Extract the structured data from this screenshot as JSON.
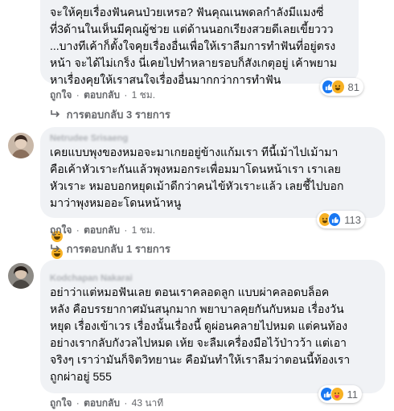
{
  "comments": [
    {
      "author": "",
      "text": "จะให้คุยเรื่องฟันคนป่วยเหรอ? ฟันคุณเนพดลกำลังมีแมงซี่\nที่3ด้านในเห็นมีคุณผู้ช่วย แต่ด้านนอกเรียงสวยดีเลยเขี้ยววว\n...บางทีเค้าก็ตั้งใจคุยเรื่องอื่นเพื่อให้เราลืมการทำฟันที่อยู่ตรง\nหน้า จะได้ไม่เกร็ง นี่เคยไปทำหลายรอบก็สังเกตุอยู่ เค้าพยาม\nหาเรื่องคุยให้เราสนใจเรื่องอื่นมากกว่าการทำฟัน",
      "like_label": "ถูกใจ",
      "reply_label": "ตอบกลับ",
      "time": "1 ชม.",
      "reactions_count": "81",
      "replies_label": "การตอบกลับ 3 รายการ"
    },
    {
      "author": "Netrudee Srisaeng",
      "text": "เคยแบบพุงของหมอจะมาเกยอยู่ข้างแก้มเรา ทีนี้เม้าไปเม้ามา\nคือเค้าหัวเราะกันแล้วพุงหมอกระเพื่อมมาโดนหน้าเรา เราเลย\nหัวเราะ หมอบอกหยุดเม้าดีกว่าคนไข้หัวเราะแล้ว เลยชี้ไปบอก\nมาว่าพุงหมออะโดนหน้าหนู",
      "emojis": [
        "grinning",
        "grinning",
        "grinning",
        "grinning"
      ],
      "like_label": "ถูกใจ",
      "reply_label": "ตอบกลับ",
      "time": "1 ชม.",
      "reactions_count": "113",
      "replies_label": "การตอบกลับ 1 รายการ"
    },
    {
      "author": "Kodchapan Nakarai",
      "text": "อย่าว่าแต่หมอฟันเลย ตอนเราคลอดลูก แบบผ่าคลอดบล็อค\nหลัง คือบรรยากาศมันสนุกมาก พยาบาลคุยกันกับหมอ เรื่องวัน\nหยุด เรื่องเข้าเวร เรื่องนั้นเรื่องนี้ ดูผ่อนคลายไปหมด แต่คนท้อง\nอย่างเรากลับกังวลไปหมด เห้ย จะลืมเครื่องมือไว้ป่าวว้า แต่เอา\nจริงๆ เราว่ามันก็จิตวิทยานะ คือมันทำให้เราลืมว่าตอนนี้ท้องเรา\nถูกผ่าอยู่ 555",
      "like_label": "ถูกใจ",
      "reply_label": "ตอบกลับ",
      "time": "43 นาที",
      "reactions_count": "11"
    }
  ],
  "colors": {
    "bubble": "#f0f2f5",
    "secondary_text": "#65676b",
    "like_blue": "#1877f2",
    "haha_yellow": "#f7b125"
  },
  "icons": [
    "like-icon",
    "haha-icon",
    "care-icon",
    "reply-arrow-icon",
    "avatar-placeholder"
  ]
}
